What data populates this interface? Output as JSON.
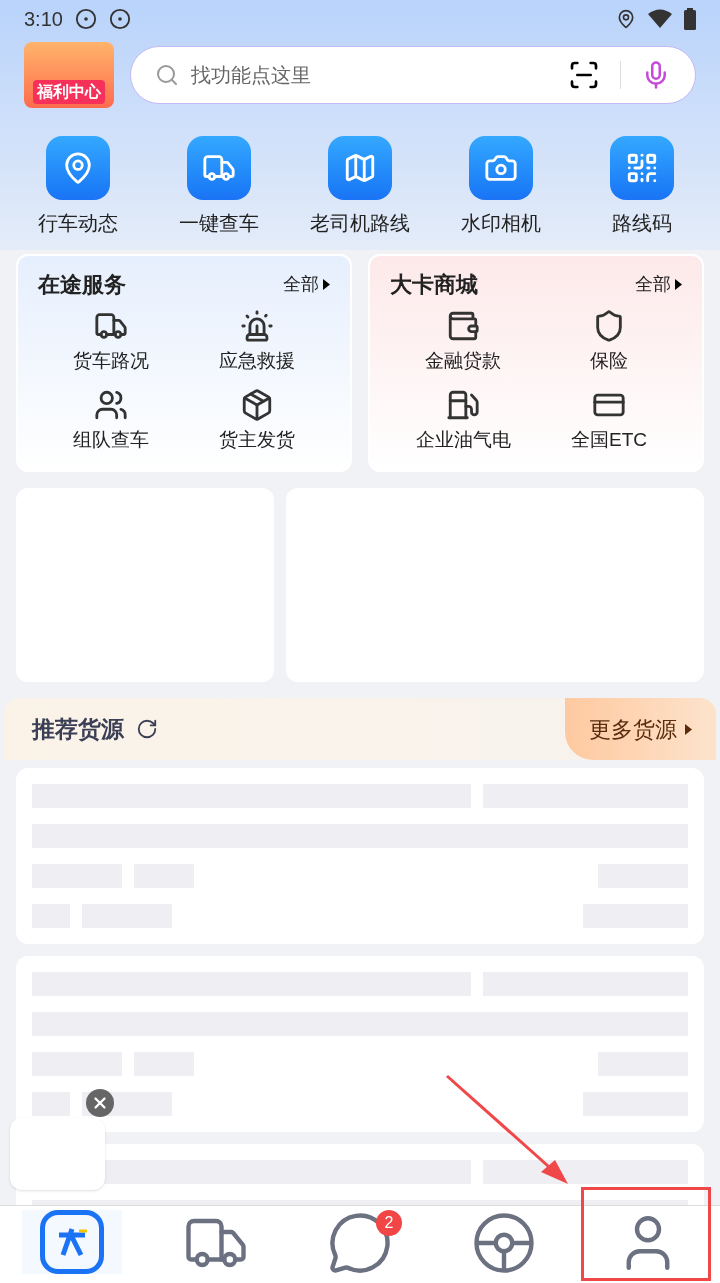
{
  "status_bar": {
    "time": "3:10"
  },
  "header": {
    "welfare_badge": "福利中心",
    "search": {
      "placeholder": "找功能点这里"
    }
  },
  "quick_tools": [
    "行车动态",
    "一键查车",
    "老司机路线",
    "水印相机",
    "路线码"
  ],
  "panels": [
    {
      "title": "在途服务",
      "more": "全部",
      "items": [
        "货车路况",
        "应急救援",
        "组队查车",
        "货主发货"
      ]
    },
    {
      "title": "大卡商城",
      "more": "全部",
      "items": [
        "金融贷款",
        "保险",
        "企业油气电",
        "全国ETC"
      ]
    }
  ],
  "recommend": {
    "title": "推荐货源",
    "more": "更多货源"
  },
  "bottom_nav": [
    {
      "selected": true
    },
    {
      "selected": false
    },
    {
      "selected": false,
      "badge": "2"
    },
    {
      "selected": false
    },
    {
      "selected": false
    }
  ]
}
